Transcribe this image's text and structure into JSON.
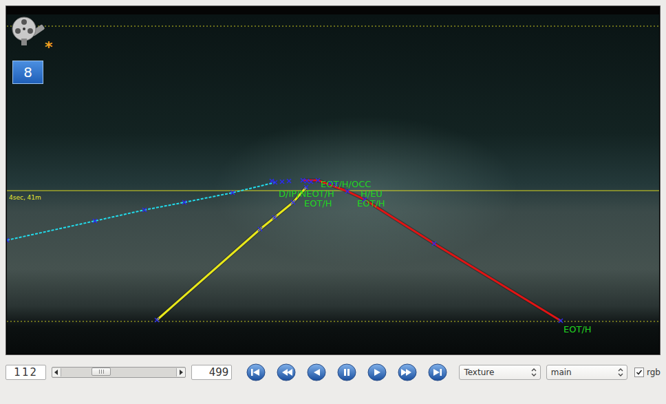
{
  "viewer": {
    "badge": "8",
    "modified_mark": "*",
    "horizon_label": "4sec, 41m",
    "lanes": [
      {
        "name": "left-adjacent",
        "kind": "dashed",
        "color": "#22dcec"
      },
      {
        "name": "ego-left",
        "kind": "solid",
        "color": "#e8e81a"
      },
      {
        "name": "ego-right",
        "kind": "solid",
        "color": "#e01414"
      }
    ],
    "labels": [
      "D/IP/NEOT/H",
      "EOT/H/OCC",
      "H/EU",
      "EOT/H",
      "EOT/H",
      "EOT/H"
    ]
  },
  "controls": {
    "frame": "112",
    "total": "499",
    "slider": {
      "level": 0.28
    },
    "view_select": "Texture",
    "layer_select": "main",
    "rgb": {
      "label": "rgb",
      "checked": true
    }
  }
}
